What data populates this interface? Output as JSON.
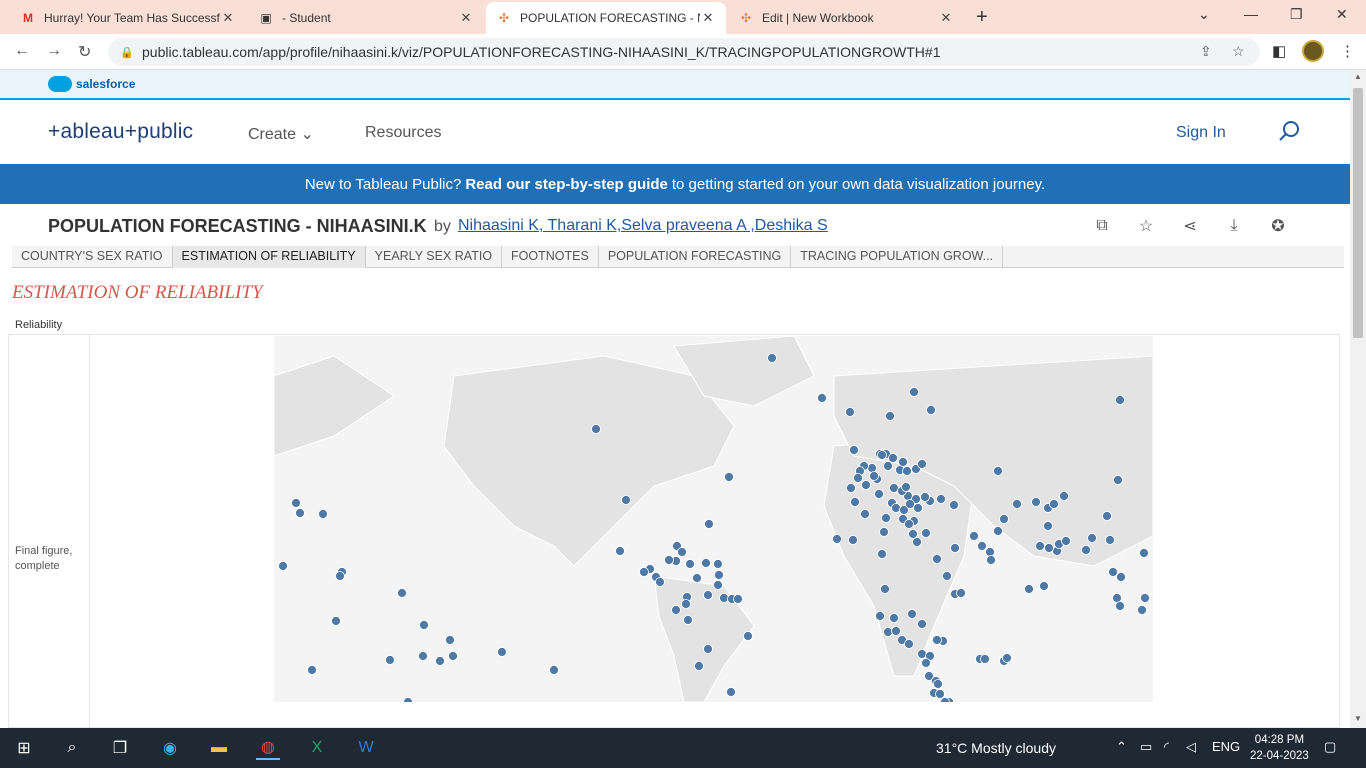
{
  "browser": {
    "tabs": [
      {
        "title": "Hurray! Your Team Has Successfu",
        "icon": "gmail-icon",
        "active": false
      },
      {
        "title": "- Student",
        "icon": "page-icon",
        "active": false
      },
      {
        "title": "POPULATION FORECASTING - NI",
        "icon": "tableau-icon",
        "active": true
      },
      {
        "title": "Edit | New Workbook",
        "icon": "tableau-icon",
        "active": false
      }
    ],
    "url": "public.tableau.com/app/profile/nihaasini.k/viz/POPULATIONFORECASTING-NIHAASINI_K/TRACINGPOPULATIONGROWTH#1"
  },
  "salesforce": {
    "label": "salesforce"
  },
  "tableau_header": {
    "logo": "+ableau+public",
    "nav": [
      "Create",
      "Resources"
    ],
    "sign_in": "Sign In"
  },
  "banner": {
    "prefix": "New to Tableau Public?",
    "link": "Read our step-by-step guide",
    "suffix": "to getting started on your own data visualization journey."
  },
  "viz": {
    "title": "POPULATION FORECASTING - NIHAASINI.K",
    "by": "by",
    "authors": "Nihaasini K, Tharani K,Selva praveena A ,Deshika S",
    "tabs": [
      "COUNTRY'S SEX RATIO",
      "ESTIMATION OF RELIABILITY",
      "YEARLY SEX RATIO",
      "FOOTNOTES",
      "POPULATION FORECASTING",
      "TRACING POPULATION GROW..."
    ],
    "active_tab": 1,
    "sheet_title": "ESTIMATION OF RELIABILITY",
    "row_header": "Reliability",
    "row_label": "Final figure, complete",
    "dot_color": "#4e79a7"
  },
  "taskbar": {
    "weather": "31°C  Mostly cloudy",
    "lang": "ENG",
    "time": "04:28 PM",
    "date": "22-04-2023"
  }
}
